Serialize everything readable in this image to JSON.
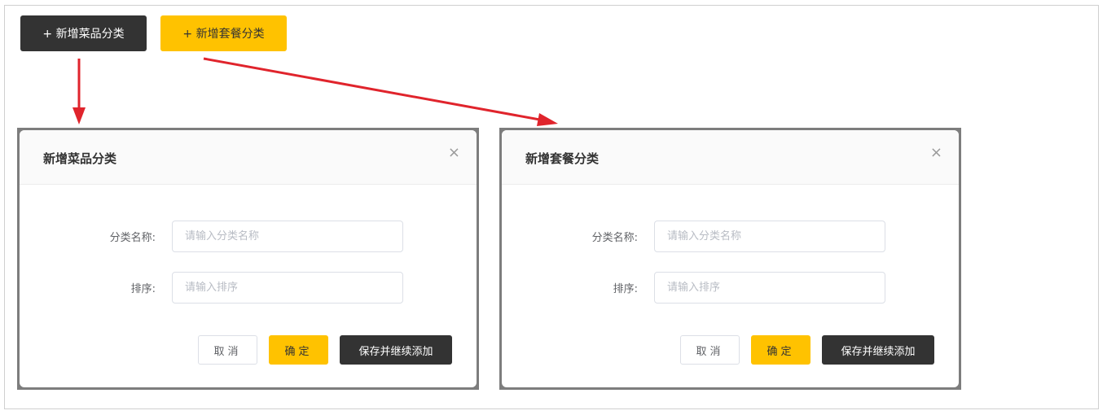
{
  "top_buttons": {
    "add_dish_category": "+ 新增菜品分类",
    "add_set_category": "+ 新增套餐分类"
  },
  "dialogs": [
    {
      "title": "新增菜品分类",
      "close": "×",
      "name_label": "分类名称:",
      "name_placeholder": "请输入分类名称",
      "sort_label": "排序:",
      "sort_placeholder": "请输入排序",
      "cancel": "取消",
      "confirm": "确定",
      "save_continue": "保存并继续添加"
    },
    {
      "title": "新增套餐分类",
      "close": "×",
      "name_label": "分类名称:",
      "name_placeholder": "请输入分类名称",
      "sort_label": "排序:",
      "sort_placeholder": "请输入排序",
      "cancel": "取消",
      "confirm": "确定",
      "save_continue": "保存并继续添加"
    }
  ],
  "colors": {
    "dark": "#333333",
    "accent": "#ffc200",
    "arrow": "#e0242c"
  }
}
